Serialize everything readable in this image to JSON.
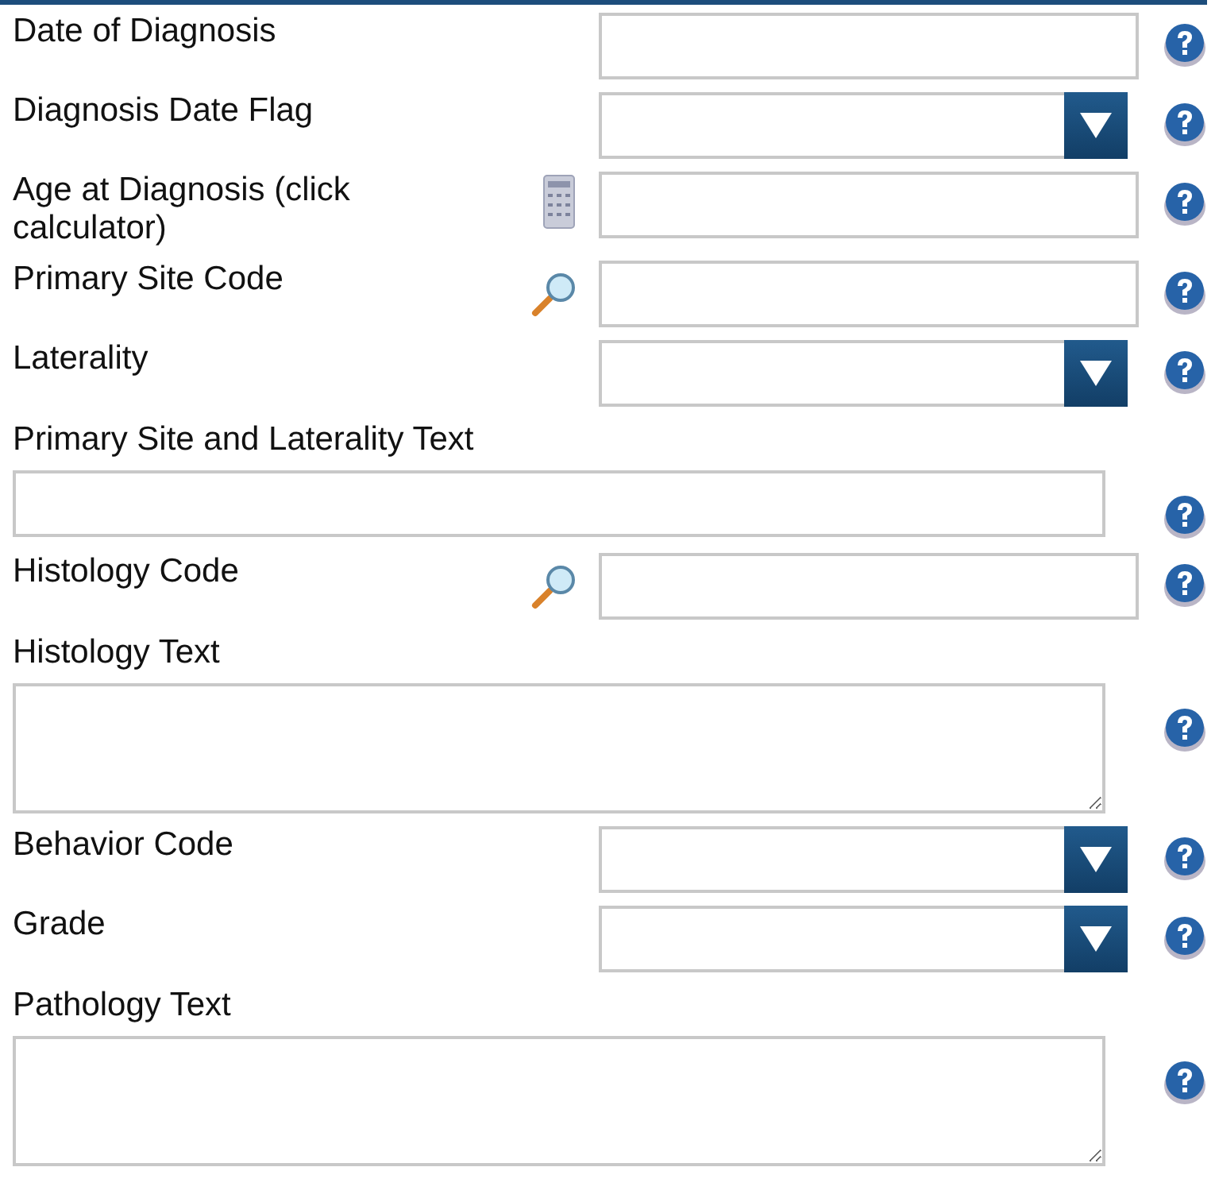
{
  "fields": [
    {
      "label": "Date of Diagnosis",
      "kind": "text"
    },
    {
      "label": "Diagnosis Date Flag",
      "kind": "select"
    },
    {
      "label": "Age at Diagnosis (click calculator)",
      "kind": "calculator"
    },
    {
      "label": "Primary Site Code",
      "kind": "search"
    },
    {
      "label": "Laterality",
      "kind": "select"
    },
    {
      "label": "Primary Site and Laterality Text",
      "kind": "widetext"
    },
    {
      "label": "Histology Code",
      "kind": "search"
    },
    {
      "label": "Histology Text",
      "kind": "textarea"
    },
    {
      "label": "Behavior Code",
      "kind": "select"
    },
    {
      "label": "Grade",
      "kind": "select"
    },
    {
      "label": "Pathology Text",
      "kind": "textarea"
    }
  ]
}
